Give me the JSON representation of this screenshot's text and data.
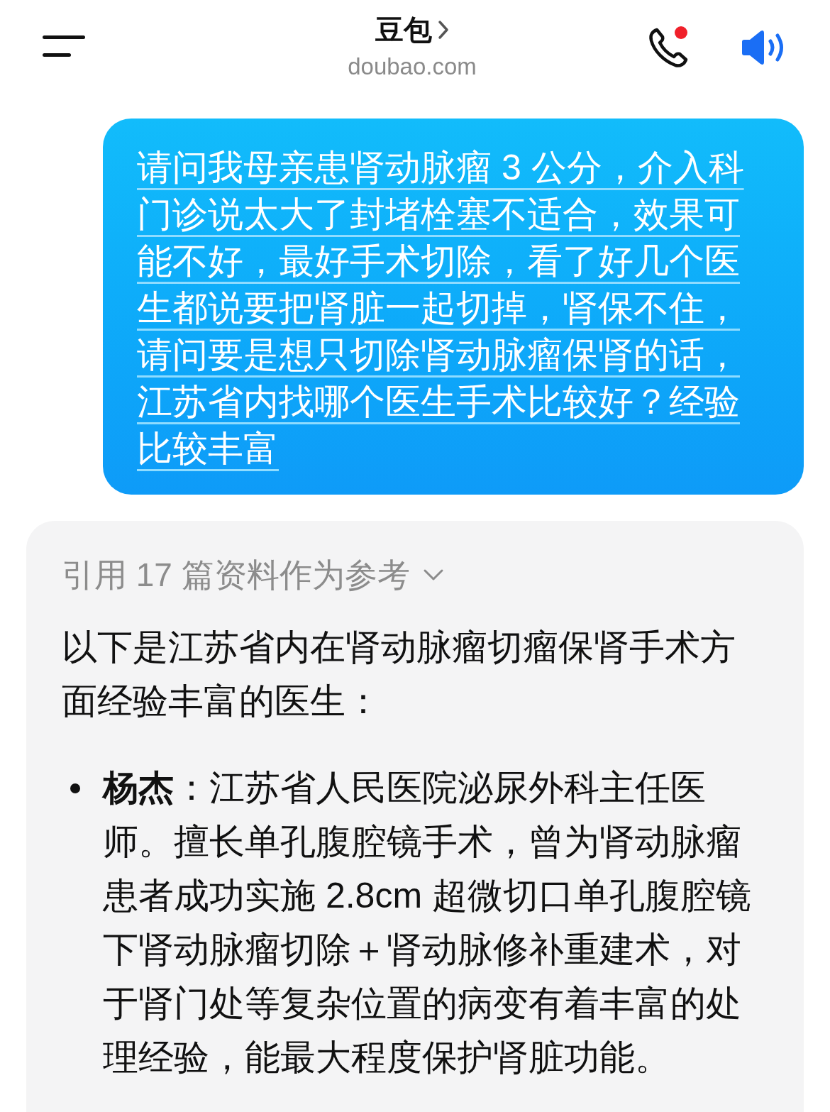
{
  "header": {
    "title": "豆包",
    "subtitle": "doubao.com",
    "call_notification": true
  },
  "user_message": "请问我母亲患肾动脉瘤 3 公分，介入科门诊说太大了封堵栓塞不适合，效果可能不好，最好手术切除，看了好几个医生都说要把肾脏一起切掉，肾保不住，请问要是想只切除肾动脉瘤保肾的话，江苏省内找哪个医生手术比较好？经验比较丰富",
  "answer": {
    "references": "引用 17 篇资料作为参考",
    "intro": "以下是江苏省内在肾动脉瘤切瘤保肾手术方面经验丰富的医生：",
    "bullets": [
      "**杨杰**：江苏省人民医院泌尿外科主任医师。擅长单孔腹腔镜手术，曾为肾动脉瘤患者成功实施 2.8cm 超微切口单孔腹腔镜下肾动脉瘤切除＋肾动脉修补重建术，对于肾门处等复杂位置的病变有着丰富的处理经验，能最大程度保护肾脏功能。"
    ]
  }
}
